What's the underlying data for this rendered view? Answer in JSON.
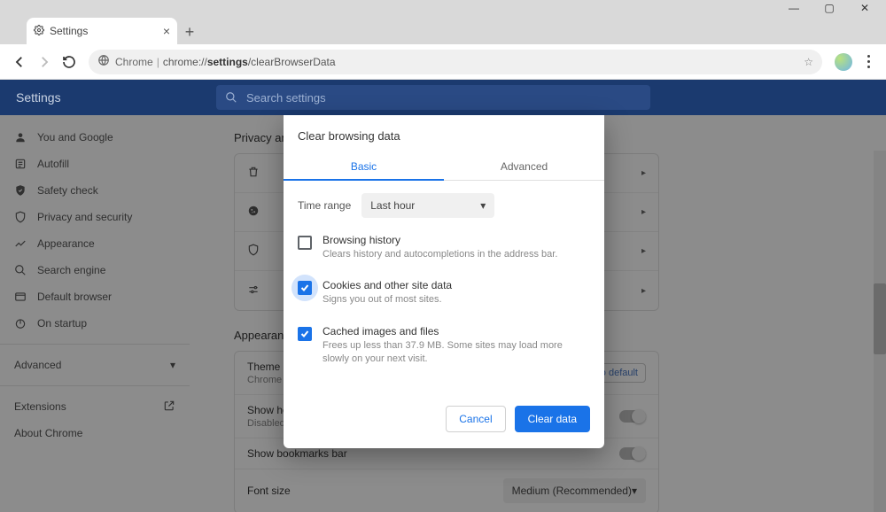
{
  "window": {
    "tab_title": "Settings"
  },
  "omnibox": {
    "label": "Chrome",
    "url_prefix": "chrome://",
    "url_bold": "settings",
    "url_rest": "/clearBrowserData"
  },
  "header": {
    "title": "Settings",
    "search_placeholder": "Search settings"
  },
  "sidebar": {
    "items": [
      {
        "label": "You and Google"
      },
      {
        "label": "Autofill"
      },
      {
        "label": "Safety check"
      },
      {
        "label": "Privacy and security"
      },
      {
        "label": "Appearance"
      },
      {
        "label": "Search engine"
      },
      {
        "label": "Default browser"
      },
      {
        "label": "On startup"
      }
    ],
    "advanced": "Advanced",
    "extensions": "Extensions",
    "about": "About Chrome"
  },
  "sections": {
    "privacy_title": "Privacy and security",
    "appearance_title": "Appearance"
  },
  "appearance": {
    "theme_label": "Theme",
    "theme_sub": "Chrome",
    "reset": "set to default",
    "show_home_label": "Show home button",
    "show_home_sub": "Disabled",
    "bookmarks_label": "Show bookmarks bar",
    "fontsize_label": "Font size",
    "fontsize_value": "Medium (Recommended)"
  },
  "dialog": {
    "title": "Clear browsing data",
    "tab_basic": "Basic",
    "tab_advanced": "Advanced",
    "timerange_label": "Time range",
    "timerange_value": "Last hour",
    "options": [
      {
        "title": "Browsing history",
        "desc": "Clears history and autocompletions in the address bar.",
        "checked": false,
        "halo": false
      },
      {
        "title": "Cookies and other site data",
        "desc": "Signs you out of most sites.",
        "checked": true,
        "halo": true
      },
      {
        "title": "Cached images and files",
        "desc": "Frees up less than 37.9 MB. Some sites may load more slowly on your next visit.",
        "checked": true,
        "halo": false
      }
    ],
    "cancel": "Cancel",
    "clear": "Clear data"
  }
}
